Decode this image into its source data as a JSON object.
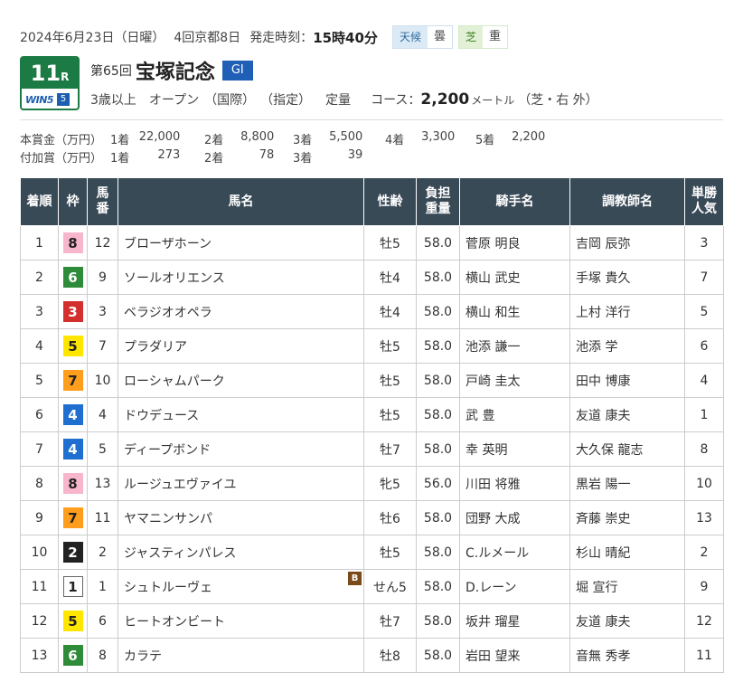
{
  "header": {
    "date": "2024年6月23日（日曜）",
    "meeting": "4回京都8日",
    "start_label": "発走時刻：",
    "start_time": "15時40分",
    "weather_label": "天候",
    "weather_value": "曇",
    "track_label": "芝",
    "track_value": "重"
  },
  "race": {
    "number": "11",
    "number_suffix": "R",
    "win5_text": "WIN5",
    "win5_leg": "5",
    "ordinal": "第65回",
    "name": "宝塚記念",
    "grade": "GI",
    "conditions": [
      "3歳以上",
      "オープン",
      "（国際）",
      "（指定）",
      "定量"
    ],
    "course_label": "コース：",
    "distance": "2,200",
    "distance_unit": "メートル",
    "course_detail": "（芝・右 外）"
  },
  "prizes": {
    "main_label": "本賞金（万円）",
    "main": [
      {
        "pos": "1着",
        "amt": "22,000"
      },
      {
        "pos": "2着",
        "amt": "8,800"
      },
      {
        "pos": "3着",
        "amt": "5,500"
      },
      {
        "pos": "4着",
        "amt": "3,300"
      },
      {
        "pos": "5着",
        "amt": "2,200"
      }
    ],
    "extra_label": "付加賞（万円）",
    "extra": [
      {
        "pos": "1着",
        "amt": "273"
      },
      {
        "pos": "2着",
        "amt": "78"
      },
      {
        "pos": "3着",
        "amt": "39"
      }
    ]
  },
  "table": {
    "headers": {
      "place": "着順",
      "waku": "枠",
      "umaban": "馬\n番",
      "horse": "馬名",
      "sexage": "性齢",
      "weight": "負担\n重量",
      "jockey": "騎手名",
      "trainer": "調教師名",
      "pop": "単勝\n人気"
    },
    "rows": [
      {
        "place": "1",
        "waku": "8",
        "umaban": "12",
        "horse": "ブローザホーン",
        "blinker": "",
        "sexage": "牡5",
        "weight": "58.0",
        "jockey": "菅原 明良",
        "trainer": "吉岡 辰弥",
        "pop": "3"
      },
      {
        "place": "2",
        "waku": "6",
        "umaban": "9",
        "horse": "ソールオリエンス",
        "blinker": "",
        "sexage": "牡4",
        "weight": "58.0",
        "jockey": "横山 武史",
        "trainer": "手塚 貴久",
        "pop": "7"
      },
      {
        "place": "3",
        "waku": "3",
        "umaban": "3",
        "horse": "ベラジオオペラ",
        "blinker": "",
        "sexage": "牡4",
        "weight": "58.0",
        "jockey": "横山 和生",
        "trainer": "上村 洋行",
        "pop": "5"
      },
      {
        "place": "4",
        "waku": "5",
        "umaban": "7",
        "horse": "プラダリア",
        "blinker": "",
        "sexage": "牡5",
        "weight": "58.0",
        "jockey": "池添 謙一",
        "trainer": "池添 学",
        "pop": "6"
      },
      {
        "place": "5",
        "waku": "7",
        "umaban": "10",
        "horse": "ローシャムパーク",
        "blinker": "",
        "sexage": "牡5",
        "weight": "58.0",
        "jockey": "戸崎 圭太",
        "trainer": "田中 博康",
        "pop": "4"
      },
      {
        "place": "6",
        "waku": "4",
        "umaban": "4",
        "horse": "ドウデュース",
        "blinker": "",
        "sexage": "牡5",
        "weight": "58.0",
        "jockey": "武 豊",
        "trainer": "友道 康夫",
        "pop": "1"
      },
      {
        "place": "7",
        "waku": "4",
        "umaban": "5",
        "horse": "ディープボンド",
        "blinker": "",
        "sexage": "牡7",
        "weight": "58.0",
        "jockey": "幸 英明",
        "trainer": "大久保 龍志",
        "pop": "8"
      },
      {
        "place": "8",
        "waku": "8",
        "umaban": "13",
        "horse": "ルージュエヴァイユ",
        "blinker": "",
        "sexage": "牝5",
        "weight": "56.0",
        "jockey": "川田 将雅",
        "trainer": "黒岩 陽一",
        "pop": "10"
      },
      {
        "place": "9",
        "waku": "7",
        "umaban": "11",
        "horse": "ヤマニンサンパ",
        "blinker": "",
        "sexage": "牡6",
        "weight": "58.0",
        "jockey": "団野 大成",
        "trainer": "斉藤 崇史",
        "pop": "13"
      },
      {
        "place": "10",
        "waku": "2",
        "umaban": "2",
        "horse": "ジャスティンパレス",
        "blinker": "",
        "sexage": "牡5",
        "weight": "58.0",
        "jockey": "C.ルメール",
        "trainer": "杉山 晴紀",
        "pop": "2"
      },
      {
        "place": "11",
        "waku": "1",
        "umaban": "1",
        "horse": "シュトルーヴェ",
        "blinker": "B",
        "sexage": "せん5",
        "weight": "58.0",
        "jockey": "D.レーン",
        "trainer": "堀 宣行",
        "pop": "9"
      },
      {
        "place": "12",
        "waku": "5",
        "umaban": "6",
        "horse": "ヒートオンビート",
        "blinker": "",
        "sexage": "牡7",
        "weight": "58.0",
        "jockey": "坂井 瑠星",
        "trainer": "友道 康夫",
        "pop": "12"
      },
      {
        "place": "13",
        "waku": "6",
        "umaban": "8",
        "horse": "カラテ",
        "blinker": "",
        "sexage": "牡8",
        "weight": "58.0",
        "jockey": "岩田 望来",
        "trainer": "音無 秀孝",
        "pop": "11"
      }
    ]
  },
  "waku_colors": {
    "1": {
      "bg": "#ffffff",
      "fg": "#222222",
      "border": "#666666"
    },
    "2": {
      "bg": "#222222",
      "fg": "#ffffff",
      "border": "#222222"
    },
    "3": {
      "bg": "#d32f2f",
      "fg": "#ffffff",
      "border": "#d32f2f"
    },
    "4": {
      "bg": "#1e6fd0",
      "fg": "#ffffff",
      "border": "#1e6fd0"
    },
    "5": {
      "bg": "#ffe600",
      "fg": "#222222",
      "border": "#ffe600"
    },
    "6": {
      "bg": "#2e8b3a",
      "fg": "#ffffff",
      "border": "#2e8b3a"
    },
    "7": {
      "bg": "#ff9d1c",
      "fg": "#222222",
      "border": "#ff9d1c"
    },
    "8": {
      "bg": "#f7b6cc",
      "fg": "#222222",
      "border": "#f7b6cc"
    }
  }
}
